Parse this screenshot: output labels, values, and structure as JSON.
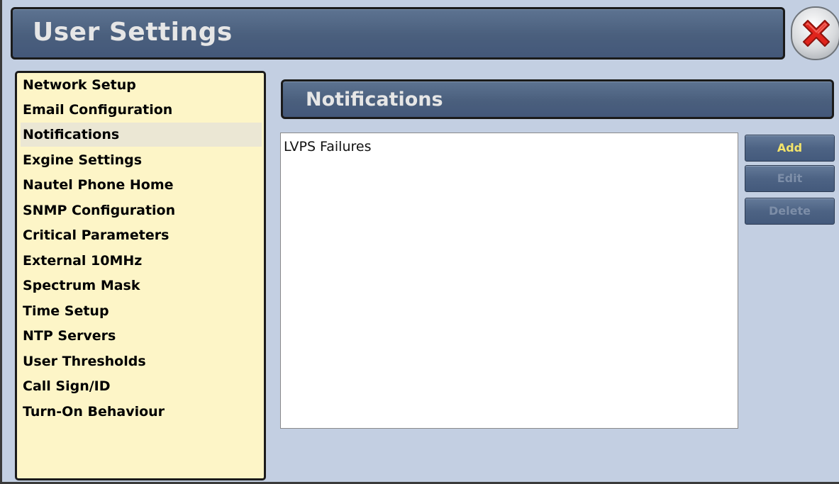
{
  "window": {
    "title": "User Settings",
    "close_icon": "close-x-icon"
  },
  "colors": {
    "header_bg": "#4a5f7d",
    "header_text": "#e6e6e6",
    "sidebar_bg": "#fdf5c7",
    "selected_bg": "#ebe7d4",
    "button_label_enabled": "#f4e46a",
    "button_label_disabled": "#7d8ea8",
    "close_x": "#e0241c"
  },
  "sidebar": {
    "selected": "Notifications",
    "items": [
      {
        "label": "Network Setup"
      },
      {
        "label": "Email Configuration"
      },
      {
        "label": "Notifications"
      },
      {
        "label": "Exgine Settings"
      },
      {
        "label": "Nautel Phone Home"
      },
      {
        "label": "SNMP Configuration"
      },
      {
        "label": "Critical Parameters"
      },
      {
        "label": "External 10MHz"
      },
      {
        "label": "Spectrum Mask"
      },
      {
        "label": "Time Setup"
      },
      {
        "label": "NTP Servers"
      },
      {
        "label": "User Thresholds"
      },
      {
        "label": "Call Sign/ID"
      },
      {
        "label": "Turn-On Behaviour"
      }
    ]
  },
  "main": {
    "section_title": "Notifications",
    "list": {
      "items": [
        {
          "label": "LVPS Failures"
        }
      ]
    },
    "buttons": {
      "add": {
        "label": "Add",
        "enabled": true
      },
      "edit": {
        "label": "Edit",
        "enabled": false
      },
      "delete": {
        "label": "Delete",
        "enabled": false
      }
    }
  }
}
